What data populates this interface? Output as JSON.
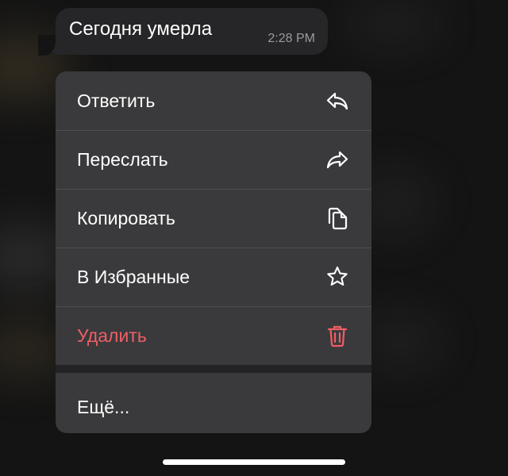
{
  "message": {
    "text": "Сегодня умерла",
    "time": "2:28 PM"
  },
  "menu": {
    "items": [
      {
        "label": "Ответить",
        "icon": "reply-icon"
      },
      {
        "label": "Переслать",
        "icon": "forward-icon"
      },
      {
        "label": "Копировать",
        "icon": "copy-icon"
      },
      {
        "label": "В Избранные",
        "icon": "star-icon"
      },
      {
        "label": "Удалить",
        "icon": "trash-icon"
      }
    ],
    "more": {
      "label": "Ещё..."
    }
  },
  "colors": {
    "background": "#141414",
    "bubble": "#262628",
    "menu": "#3a3a3c",
    "destructive": "#ee5f66",
    "text": "#ffffff",
    "time": "#9b9b9e"
  }
}
